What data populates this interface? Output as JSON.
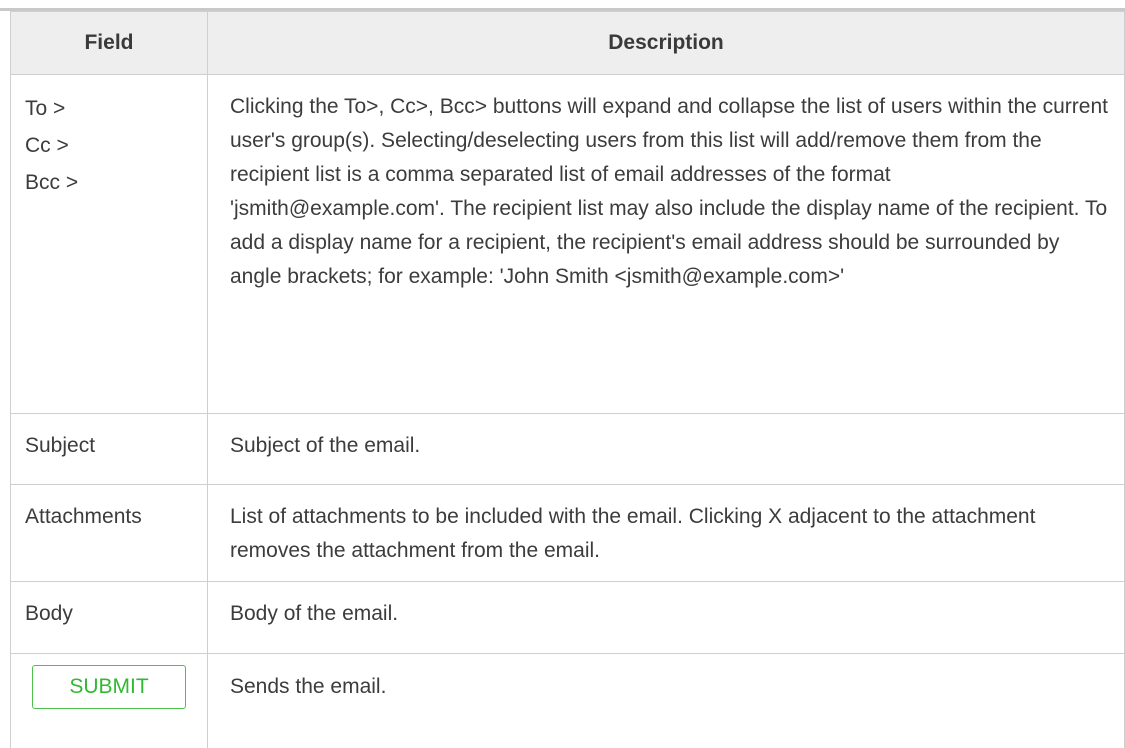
{
  "table": {
    "headers": {
      "field": "Field",
      "description": "Description"
    },
    "rows": [
      {
        "field_lines": [
          "To >",
          "Cc >",
          "Bcc >"
        ],
        "description": "Clicking the To>, Cc>, Bcc> buttons will expand and collapse the list of users within the current user's group(s). Selecting/deselecting users from this list will add/remove them from the recipient list is a comma separated list of email addresses of the format 'jsmith@example.com'. The recipient list may also include the display name of the recipient. To add a display name for a recipient, the recipient's email address should be surrounded by angle brackets; for example: 'John Smith <jsmith@example.com>'"
      },
      {
        "field": "Subject",
        "description": "Subject of the email."
      },
      {
        "field": "Attachments",
        "description": "List of attachments to be included with the email. Clicking X adjacent to the attachment removes the attachment from the email."
      },
      {
        "field": "Body",
        "description": "Body of the email."
      },
      {
        "field_button": "SUBMIT",
        "description": "Sends the email."
      }
    ]
  },
  "colors": {
    "header_bg": "#eeeeee",
    "border": "#cfcfcf",
    "text": "#3c3c3c",
    "submit_green": "#33b833"
  }
}
